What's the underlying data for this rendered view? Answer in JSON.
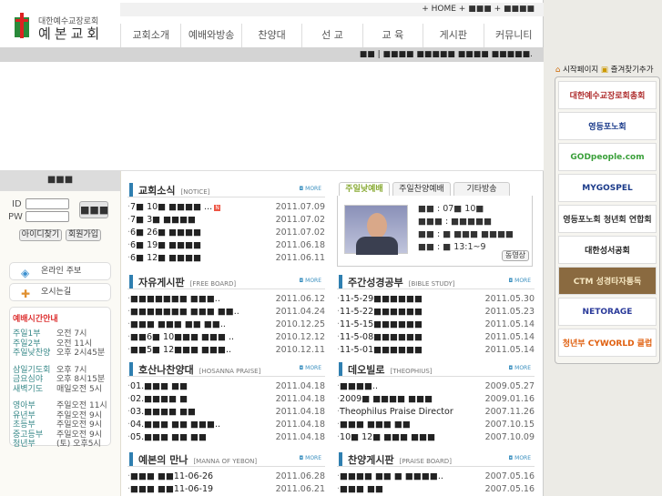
{
  "header": {
    "logo_sub": "대한예수교장로회",
    "logo_main": "예본교회",
    "top_links": "+ HOME + ■■■ + ■■■■",
    "nav": [
      "교회소개",
      "예배와방송",
      "찬양대",
      "선 교",
      "교 육",
      "게시판",
      "커뮤니티"
    ],
    "notice_bar": "■■ | ■■■■ ■■■■■ ■■■■ ■■■■■."
  },
  "login": {
    "title": "■■■",
    "id_label": "ID",
    "pw_label": "PW",
    "login_button": "■■■",
    "find_id": "아이디찾기",
    "join": "회원가입"
  },
  "quick": {
    "bulletin": "온라인 주보",
    "directions": "오시는길"
  },
  "worship": {
    "title": "예배시간안내",
    "groups": [
      [
        [
          "주일1부",
          "오전 7시"
        ],
        [
          "주일2부",
          "오전 11시"
        ],
        [
          "주일낮찬양",
          "오후 2시45분"
        ]
      ],
      [
        [
          "삼일기도회",
          "오후 7시"
        ],
        [
          "금요심야",
          "오후 8시15분"
        ],
        [
          "새벽기도",
          "매일오전 5시"
        ]
      ],
      [
        [
          "영아부",
          "주일오전 11시"
        ],
        [
          "유년부",
          "주일오전 9시"
        ],
        [
          "초등부",
          "주일오전 9시"
        ],
        [
          "중고등부",
          "주일오전 9시"
        ],
        [
          "청년부",
          "(토) 오후5시"
        ]
      ]
    ]
  },
  "boards": [
    {
      "title": "교회소식",
      "sub": "[NOTICE]",
      "more": "MORE",
      "rows": [
        [
          "7■ 10■ ■■■■ ...",
          "2011.07.09",
          true
        ],
        [
          "7■ 3■ ■■■■",
          "2011.07.02"
        ],
        [
          "6■ 26■ ■■■■",
          "2011.07.02"
        ],
        [
          "6■ 19■ ■■■■",
          "2011.06.18"
        ],
        [
          "6■ 12■ ■■■■",
          "2011.06.11"
        ]
      ]
    },
    {
      "title": "자유게시판",
      "sub": "[FREE BOARD]",
      "more": "MORE",
      "rows": [
        [
          "■■■■■■■ ■■■..",
          "2011.06.12"
        ],
        [
          "■■■■■■■ ■■■ ■■..",
          "2011.04.24"
        ],
        [
          "■■■ ■■■ ■■ ■■..",
          "2010.12.25"
        ],
        [
          "■■6■ 10■■■ ■■■ ..",
          "2010.12.12"
        ],
        [
          "■■5■ 12■■■ ■■■..",
          "2010.12.11"
        ]
      ]
    },
    {
      "title": "호산나찬양대",
      "sub": "[HOSANNA PRAISE]",
      "more": "MORE",
      "rows": [
        [
          "01.■■■ ■■",
          "2011.04.18"
        ],
        [
          "02.■■■■ ■",
          "2011.04.18"
        ],
        [
          "03.■■■■ ■■",
          "2011.04.18"
        ],
        [
          "04.■■■ ■■ ■■■..",
          "2011.04.18"
        ],
        [
          "05.■■■ ■■ ■■",
          "2011.04.18"
        ]
      ]
    },
    {
      "title": "예본의 만나",
      "sub": "[MANNA OF YEBON]",
      "more": "MORE",
      "rows": [
        [
          "■■■ ■■11-06-26",
          "2011.06.28"
        ],
        [
          "■■■ ■■11-06-19",
          "2011.06.21"
        ]
      ]
    },
    {
      "title": "주간성경공부",
      "sub": "[BIBLE STUDY]",
      "more": "MORE",
      "rows": [
        [
          "11-5-29■■■■■■",
          "2011.05.30"
        ],
        [
          "11-5-22■■■■■■",
          "2011.05.23"
        ],
        [
          "11-5-15■■■■■■",
          "2011.05.14"
        ],
        [
          "11-5-08■■■■■■",
          "2011.05.14"
        ],
        [
          "11-5-01■■■■■■",
          "2011.05.14"
        ]
      ]
    },
    {
      "title": "데오빌로",
      "sub": "[THEOPHIUS]",
      "more": "MORE",
      "rows": [
        [
          "■■■■..",
          "2009.05.27"
        ],
        [
          "2009■ ■■■■ ■■■",
          "2009.01.16"
        ],
        [
          "Theophilus Praise Director",
          "2007.11.26"
        ],
        [
          "■■■ ■■■ ■■",
          "2007.10.15"
        ],
        [
          "10■ 12■ ■■■ ■■■",
          "2007.10.09"
        ]
      ]
    },
    {
      "title": "찬양게시판",
      "sub": "[PRAISE BOARD]",
      "more": "MORE",
      "rows": [
        [
          "■■■■ ■■ ■ ■■■■..",
          "2007.05.16"
        ],
        [
          "■■■ ■■",
          "2007.05.16"
        ]
      ]
    }
  ],
  "sermon": {
    "tabs": [
      "주일낮예배",
      "주일찬양예배",
      "기타방송"
    ],
    "lines": [
      "■■ : 07■ 10■",
      "■■■ : ■■■■■",
      "■■ : ■ ■■■ ■■■■",
      "■■ : ■ 13:1~9"
    ],
    "video_button": "동영상"
  },
  "sidebar": {
    "start_page": "시작페이지",
    "bookmark": "즐겨찾기추가",
    "banners": [
      [
        "대한예수교장로회총회",
        "#b03030"
      ],
      [
        "영등포노회",
        "#1a3a8a"
      ],
      [
        "GODpeople.com",
        "#3aa03a"
      ],
      [
        "MYGOSPEL",
        "#1a3a8a"
      ],
      [
        "영등포노회 청년회 연합회",
        "#333333"
      ],
      [
        "대한성서공회",
        "#222222"
      ],
      [
        "CTM 성경타자통독",
        "#f5e6c0"
      ],
      [
        "NETORAGE",
        "#2a3a9a"
      ],
      [
        "청년부 CYWORLD 클럽",
        "#e06010"
      ]
    ]
  }
}
